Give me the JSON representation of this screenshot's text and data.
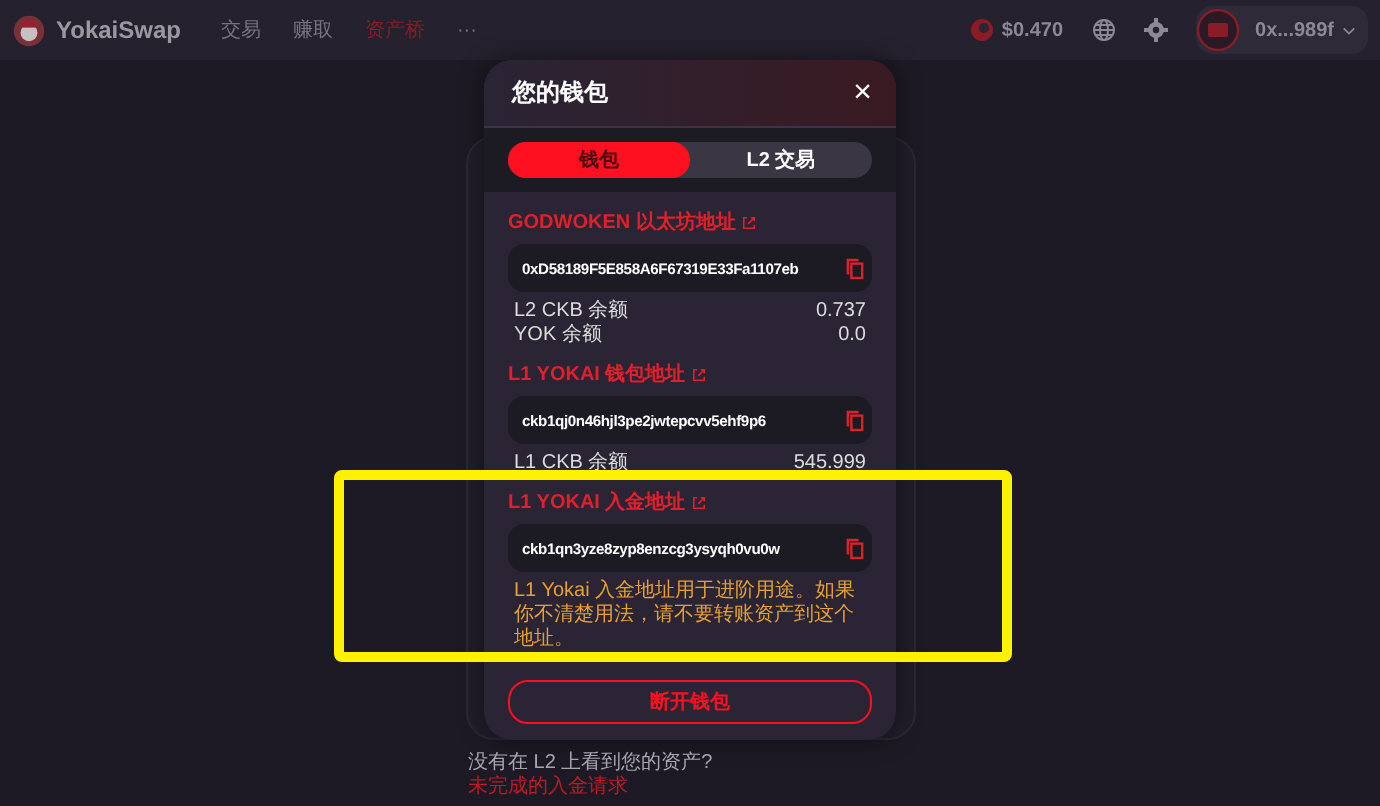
{
  "nav": {
    "brand": "YokaiSwap",
    "menu": [
      {
        "label": "交易",
        "selected": false
      },
      {
        "label": "赚取",
        "selected": false
      },
      {
        "label": "资产桥",
        "selected": true
      },
      {
        "label": "···",
        "selected": false
      }
    ],
    "price": "$0.470",
    "account": "0x...989f"
  },
  "modal": {
    "title": "您的钱包",
    "close": "×",
    "tabs": [
      {
        "label": "钱包",
        "selected": true
      },
      {
        "label": "L2 交易",
        "selected": false
      }
    ],
    "sections": [
      {
        "label": "GODWOKEN 以太坊地址",
        "address": "0xD58189F5E858A6F67319E33Fa1107eb",
        "highlighted": false,
        "balances": [
          {
            "name": "L2 CKB 余额",
            "value": "0.737"
          },
          {
            "name": "YOK 余额",
            "value": "0.0"
          }
        ]
      },
      {
        "label": "L1 YOKAI 钱包地址",
        "address": "ckb1qj0n46hjl3pe2jwtepcvv5ehf9p6",
        "highlighted": false,
        "balances": [
          {
            "name": "L1 CKB 余额",
            "value": "545.999"
          }
        ]
      },
      {
        "label": "L1 YOKAI 入金地址",
        "address": "ckb1qn3yze8zyp8enzcg3ysyqh0vu0w",
        "highlighted": true,
        "note": "L1 Yokai 入金地址用于进阶用途。如果你不清楚用法，请不要转账资产到这个地址。"
      }
    ],
    "disconnect": "断开钱包"
  },
  "footer": {
    "question": "没有在 L2 上看到您的资产?",
    "link": "未完成的入金请求"
  }
}
